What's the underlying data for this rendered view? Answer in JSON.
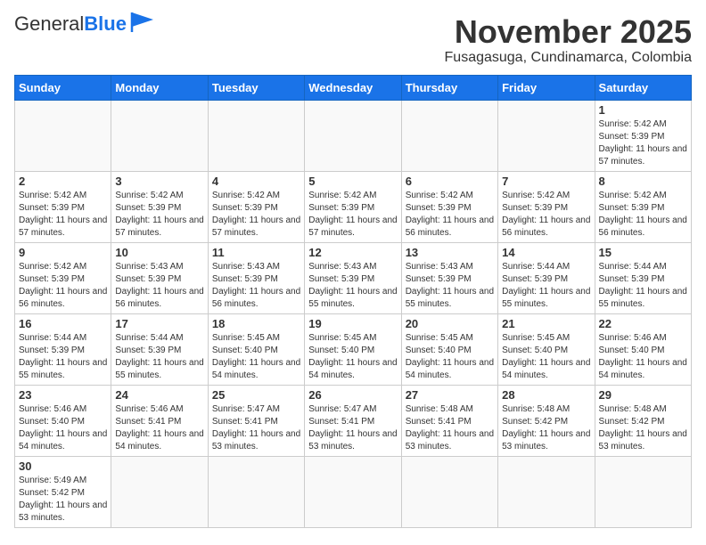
{
  "header": {
    "logo_general": "General",
    "logo_blue": "Blue",
    "month_title": "November 2025",
    "location": "Fusagasuga, Cundinamarca, Colombia"
  },
  "weekdays": [
    "Sunday",
    "Monday",
    "Tuesday",
    "Wednesday",
    "Thursday",
    "Friday",
    "Saturday"
  ],
  "weeks": [
    [
      {
        "day": "",
        "info": ""
      },
      {
        "day": "",
        "info": ""
      },
      {
        "day": "",
        "info": ""
      },
      {
        "day": "",
        "info": ""
      },
      {
        "day": "",
        "info": ""
      },
      {
        "day": "",
        "info": ""
      },
      {
        "day": "1",
        "info": "Sunrise: 5:42 AM\nSunset: 5:39 PM\nDaylight: 11 hours and 57 minutes."
      }
    ],
    [
      {
        "day": "2",
        "info": "Sunrise: 5:42 AM\nSunset: 5:39 PM\nDaylight: 11 hours and 57 minutes."
      },
      {
        "day": "3",
        "info": "Sunrise: 5:42 AM\nSunset: 5:39 PM\nDaylight: 11 hours and 57 minutes."
      },
      {
        "day": "4",
        "info": "Sunrise: 5:42 AM\nSunset: 5:39 PM\nDaylight: 11 hours and 57 minutes."
      },
      {
        "day": "5",
        "info": "Sunrise: 5:42 AM\nSunset: 5:39 PM\nDaylight: 11 hours and 57 minutes."
      },
      {
        "day": "6",
        "info": "Sunrise: 5:42 AM\nSunset: 5:39 PM\nDaylight: 11 hours and 56 minutes."
      },
      {
        "day": "7",
        "info": "Sunrise: 5:42 AM\nSunset: 5:39 PM\nDaylight: 11 hours and 56 minutes."
      },
      {
        "day": "8",
        "info": "Sunrise: 5:42 AM\nSunset: 5:39 PM\nDaylight: 11 hours and 56 minutes."
      }
    ],
    [
      {
        "day": "9",
        "info": "Sunrise: 5:42 AM\nSunset: 5:39 PM\nDaylight: 11 hours and 56 minutes."
      },
      {
        "day": "10",
        "info": "Sunrise: 5:43 AM\nSunset: 5:39 PM\nDaylight: 11 hours and 56 minutes."
      },
      {
        "day": "11",
        "info": "Sunrise: 5:43 AM\nSunset: 5:39 PM\nDaylight: 11 hours and 56 minutes."
      },
      {
        "day": "12",
        "info": "Sunrise: 5:43 AM\nSunset: 5:39 PM\nDaylight: 11 hours and 55 minutes."
      },
      {
        "day": "13",
        "info": "Sunrise: 5:43 AM\nSunset: 5:39 PM\nDaylight: 11 hours and 55 minutes."
      },
      {
        "day": "14",
        "info": "Sunrise: 5:44 AM\nSunset: 5:39 PM\nDaylight: 11 hours and 55 minutes."
      },
      {
        "day": "15",
        "info": "Sunrise: 5:44 AM\nSunset: 5:39 PM\nDaylight: 11 hours and 55 minutes."
      }
    ],
    [
      {
        "day": "16",
        "info": "Sunrise: 5:44 AM\nSunset: 5:39 PM\nDaylight: 11 hours and 55 minutes."
      },
      {
        "day": "17",
        "info": "Sunrise: 5:44 AM\nSunset: 5:39 PM\nDaylight: 11 hours and 55 minutes."
      },
      {
        "day": "18",
        "info": "Sunrise: 5:45 AM\nSunset: 5:40 PM\nDaylight: 11 hours and 54 minutes."
      },
      {
        "day": "19",
        "info": "Sunrise: 5:45 AM\nSunset: 5:40 PM\nDaylight: 11 hours and 54 minutes."
      },
      {
        "day": "20",
        "info": "Sunrise: 5:45 AM\nSunset: 5:40 PM\nDaylight: 11 hours and 54 minutes."
      },
      {
        "day": "21",
        "info": "Sunrise: 5:45 AM\nSunset: 5:40 PM\nDaylight: 11 hours and 54 minutes."
      },
      {
        "day": "22",
        "info": "Sunrise: 5:46 AM\nSunset: 5:40 PM\nDaylight: 11 hours and 54 minutes."
      }
    ],
    [
      {
        "day": "23",
        "info": "Sunrise: 5:46 AM\nSunset: 5:40 PM\nDaylight: 11 hours and 54 minutes."
      },
      {
        "day": "24",
        "info": "Sunrise: 5:46 AM\nSunset: 5:41 PM\nDaylight: 11 hours and 54 minutes."
      },
      {
        "day": "25",
        "info": "Sunrise: 5:47 AM\nSunset: 5:41 PM\nDaylight: 11 hours and 53 minutes."
      },
      {
        "day": "26",
        "info": "Sunrise: 5:47 AM\nSunset: 5:41 PM\nDaylight: 11 hours and 53 minutes."
      },
      {
        "day": "27",
        "info": "Sunrise: 5:48 AM\nSunset: 5:41 PM\nDaylight: 11 hours and 53 minutes."
      },
      {
        "day": "28",
        "info": "Sunrise: 5:48 AM\nSunset: 5:42 PM\nDaylight: 11 hours and 53 minutes."
      },
      {
        "day": "29",
        "info": "Sunrise: 5:48 AM\nSunset: 5:42 PM\nDaylight: 11 hours and 53 minutes."
      }
    ],
    [
      {
        "day": "30",
        "info": "Sunrise: 5:49 AM\nSunset: 5:42 PM\nDaylight: 11 hours and 53 minutes."
      },
      {
        "day": "",
        "info": ""
      },
      {
        "day": "",
        "info": ""
      },
      {
        "day": "",
        "info": ""
      },
      {
        "day": "",
        "info": ""
      },
      {
        "day": "",
        "info": ""
      },
      {
        "day": "",
        "info": ""
      }
    ]
  ]
}
